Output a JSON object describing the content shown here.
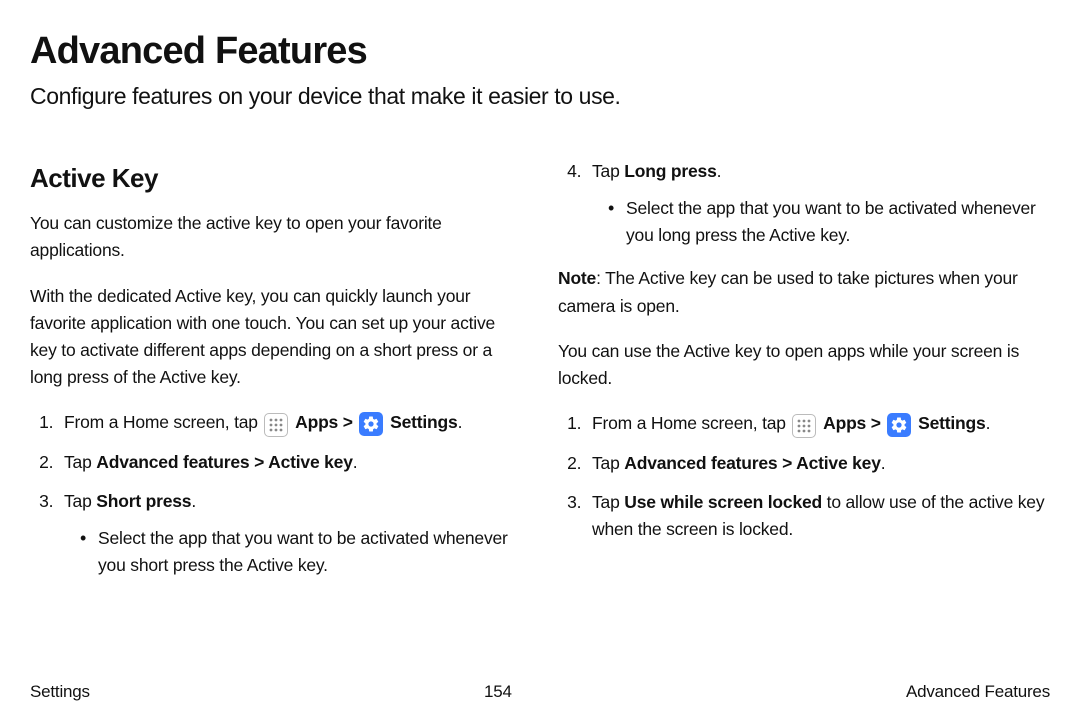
{
  "title": "Advanced Features",
  "subtitle": "Configure features on your device that make it easier to use.",
  "section": {
    "heading": "Active Key",
    "intro1": "You can customize the active key to open your favorite applications.",
    "intro2": "With the dedicated Active key, you can quickly launch your favorite application with one touch. You can set up your active key to activate different apps depending on a short press or a long press of the Active key.",
    "steps_left": {
      "s1_a": "From a Home screen, tap ",
      "s1_apps": "Apps",
      "s1_sep": " > ",
      "s1_settings": "Settings",
      "s1_end": ".",
      "s2_a": "Tap ",
      "s2_b": "Advanced features > Active key",
      "s2_end": ".",
      "s3_a": "Tap ",
      "s3_b": "Short press",
      "s3_end": ".",
      "s3_bullet": "Select the app that you want to be activated whenever you short press the Active key."
    },
    "steps_right_top": {
      "s4_a": "Tap ",
      "s4_b": "Long press",
      "s4_end": ".",
      "s4_bullet": "Select the app that you want to be activated whenever you long press the Active key."
    },
    "note_label": "Note",
    "note_text": ": The Active key can be used to take pictures when your camera is open.",
    "right_intro": "You can use the Active key to open apps while your screen is locked.",
    "steps_right": {
      "s1_a": "From a Home screen, tap ",
      "s1_apps": "Apps",
      "s1_sep": " > ",
      "s1_settings": "Settings",
      "s1_end": ".",
      "s2_a": "Tap ",
      "s2_b": "Advanced features > Active key",
      "s2_end": ".",
      "s3_a": "Tap ",
      "s3_b": "Use while screen locked",
      "s3_c": " to allow use of the active key when the screen is locked."
    }
  },
  "footer": {
    "left": "Settings",
    "center": "154",
    "right": "Advanced Features"
  }
}
